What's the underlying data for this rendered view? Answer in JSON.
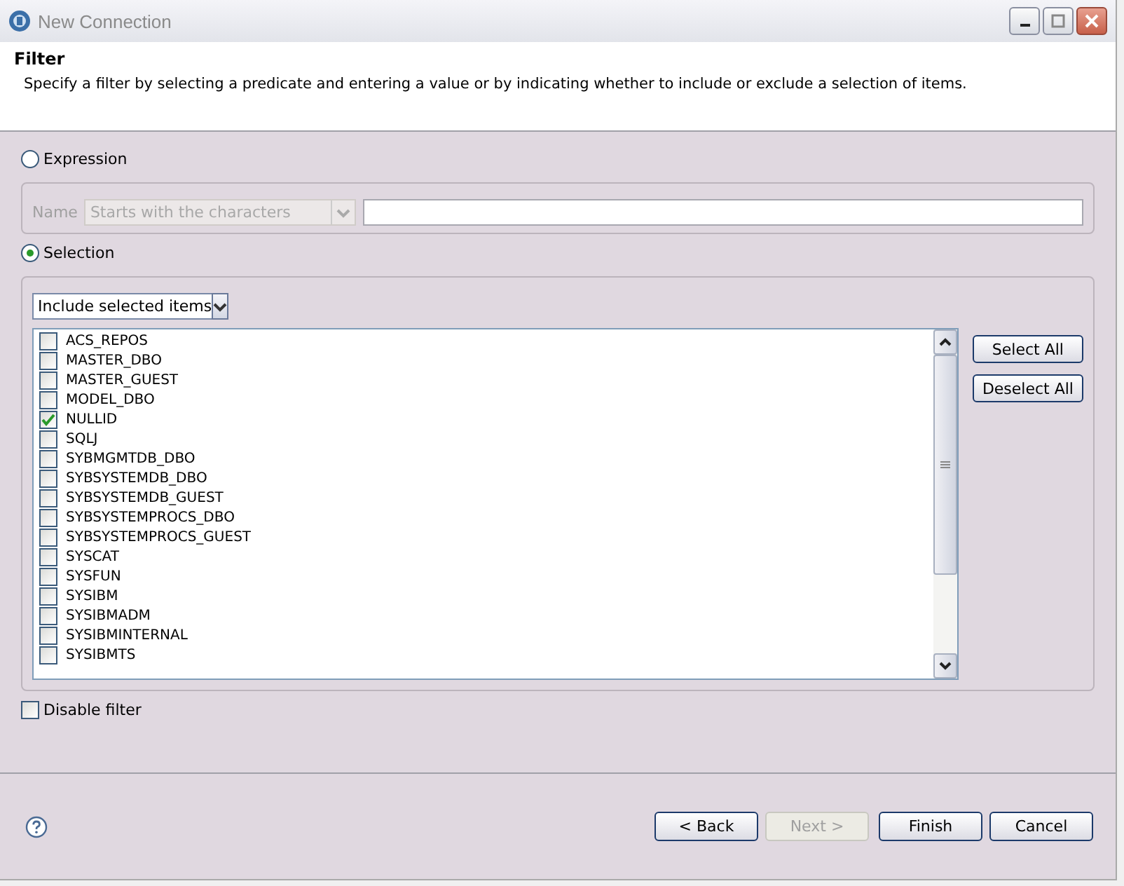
{
  "window": {
    "title": "New Connection"
  },
  "header": {
    "title": "Filter",
    "description": "Specify a filter by selecting a predicate and entering a value or by indicating whether to include or exclude a selection of items."
  },
  "expression": {
    "label": "Expression",
    "selected": false,
    "name_label": "Name",
    "predicate": "Starts with the characters",
    "disabled": true
  },
  "selection": {
    "label": "Selection",
    "selected": true,
    "mode": "Include selected items",
    "items": [
      {
        "label": "ACS_REPOS",
        "checked": false
      },
      {
        "label": "MASTER_DBO",
        "checked": false
      },
      {
        "label": "MASTER_GUEST",
        "checked": false
      },
      {
        "label": "MODEL_DBO",
        "checked": false
      },
      {
        "label": "NULLID",
        "checked": true
      },
      {
        "label": "SQLJ",
        "checked": false
      },
      {
        "label": "SYBMGMTDB_DBO",
        "checked": false
      },
      {
        "label": "SYBSYSTEMDB_DBO",
        "checked": false
      },
      {
        "label": "SYBSYSTEMDB_GUEST",
        "checked": false
      },
      {
        "label": "SYBSYSTEMPROCS_DBO",
        "checked": false
      },
      {
        "label": "SYBSYSTEMPROCS_GUEST",
        "checked": false
      },
      {
        "label": "SYSCAT",
        "checked": false
      },
      {
        "label": "SYSFUN",
        "checked": false
      },
      {
        "label": "SYSIBM",
        "checked": false
      },
      {
        "label": "SYSIBMADM",
        "checked": false
      },
      {
        "label": "SYSIBMINTERNAL",
        "checked": false
      },
      {
        "label": "SYSIBMTS",
        "checked": false
      }
    ],
    "buttons": [
      "Select All",
      "Deselect All"
    ]
  },
  "disable_filter": {
    "label": "Disable filter",
    "checked": false
  },
  "footer_buttons": [
    {
      "label": "< Back",
      "disabled": false
    },
    {
      "label": "Next >",
      "disabled": true
    },
    {
      "label": "Finish",
      "disabled": false
    },
    {
      "label": "Cancel",
      "disabled": false
    }
  ]
}
